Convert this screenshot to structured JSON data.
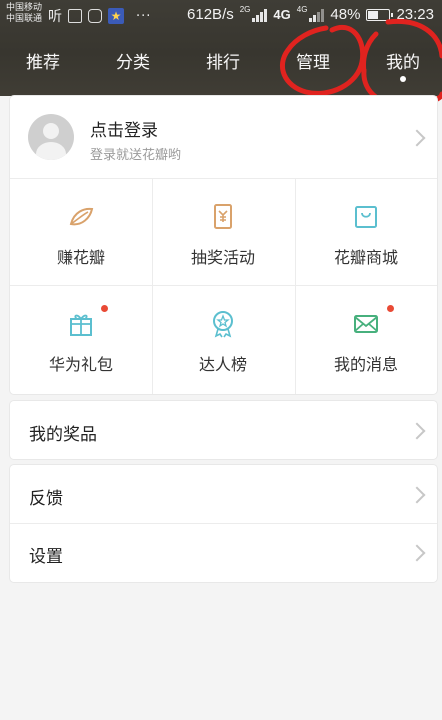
{
  "status_bar": {
    "carrier_1": "中国移动",
    "carrier_2": "中国联通",
    "listen_label": "听",
    "speed": "612B/s",
    "net_1": "2G",
    "net_2": "4G",
    "net_3": "4G",
    "battery": "48%",
    "time": "23:23"
  },
  "tabs": [
    {
      "label": "推荐"
    },
    {
      "label": "分类"
    },
    {
      "label": "排行"
    },
    {
      "label": "管理"
    },
    {
      "label": "我的"
    }
  ],
  "login": {
    "title": "点击登录",
    "subtitle": "登录就送花瓣哟"
  },
  "grid": [
    {
      "label": "赚花瓣",
      "icon": "leaf-icon",
      "badge": false
    },
    {
      "label": "抽奖活动",
      "icon": "lottery-icon",
      "badge": false
    },
    {
      "label": "花瓣商城",
      "icon": "shopping-bag-icon",
      "badge": false
    },
    {
      "label": "华为礼包",
      "icon": "gift-icon",
      "badge": true
    },
    {
      "label": "达人榜",
      "icon": "medal-icon",
      "badge": false
    },
    {
      "label": "我的消息",
      "icon": "mail-icon",
      "badge": true
    }
  ],
  "menu": {
    "prizes": "我的奖品",
    "feedback": "反馈",
    "settings": "设置"
  },
  "colors": {
    "header_bg": "#3c3a33",
    "accent_orange": "#d9a26b",
    "accent_teal": "#5bbfcf",
    "accent_green": "#47b07d",
    "badge_red": "#e94a35",
    "annotation_red": "#e0231f"
  }
}
